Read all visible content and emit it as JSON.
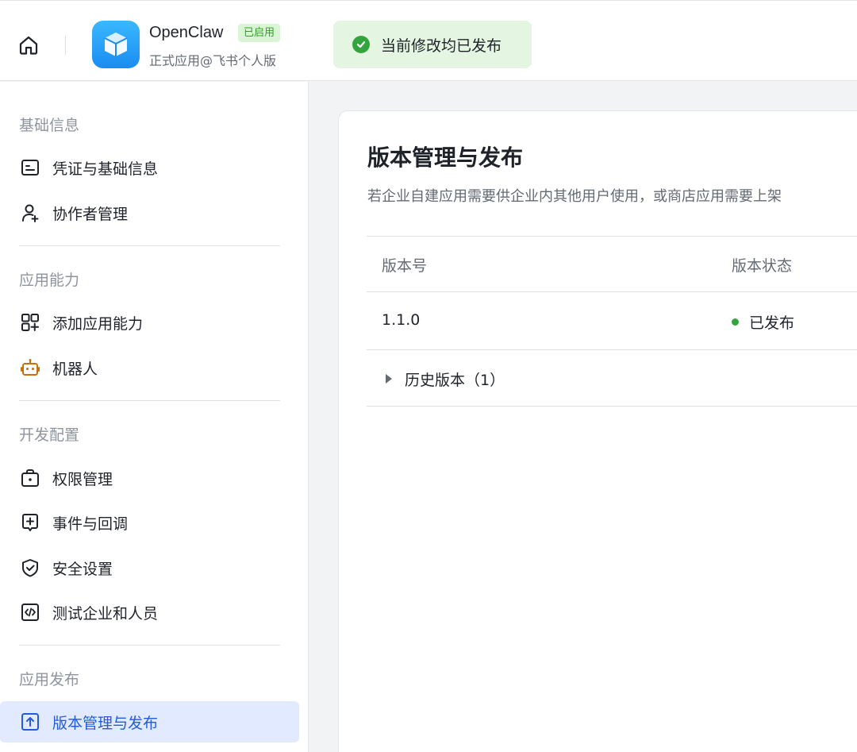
{
  "header": {
    "app_name": "OpenClaw",
    "app_badge": "已启用",
    "app_subtitle": "正式应用@飞书个人版",
    "toast_text": "当前修改均已发布",
    "colors": {
      "toast_bg": "#e4f6e2",
      "success": "#34a53d",
      "logo": "#1a8cf0"
    }
  },
  "sidebar": {
    "sections": [
      {
        "title": "基础信息",
        "items": [
          {
            "label": "凭证与基础信息",
            "icon": "credential-icon"
          },
          {
            "label": "协作者管理",
            "icon": "user-add-icon"
          }
        ]
      },
      {
        "title": "应用能力",
        "items": [
          {
            "label": "添加应用能力",
            "icon": "apps-add-icon"
          },
          {
            "label": "机器人",
            "icon": "robot-icon"
          }
        ]
      },
      {
        "title": "开发配置",
        "items": [
          {
            "label": "权限管理",
            "icon": "permission-icon"
          },
          {
            "label": "事件与回调",
            "icon": "event-icon"
          },
          {
            "label": "安全设置",
            "icon": "shield-icon"
          },
          {
            "label": "测试企业和人员",
            "icon": "code-icon"
          }
        ]
      },
      {
        "title": "应用发布",
        "items": [
          {
            "label": "版本管理与发布",
            "icon": "upload-icon",
            "active": true
          }
        ]
      }
    ],
    "colors": {
      "active_bg": "#e1eaff",
      "active_text": "#245bdb"
    }
  },
  "main": {
    "title": "版本管理与发布",
    "description": "若企业自建应用需要供企业内其他用户使用，或商店应用需要上架",
    "table": {
      "columns": [
        "版本号",
        "版本状态"
      ],
      "rows": [
        {
          "version": "1.1.0",
          "status": "已发布"
        }
      ]
    },
    "history_label": "历史版本（1）"
  }
}
